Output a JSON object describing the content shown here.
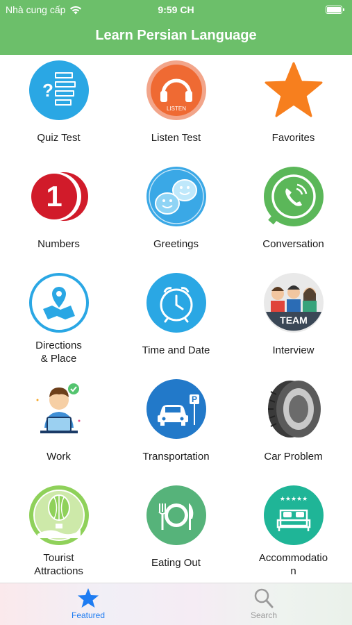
{
  "status_bar": {
    "carrier": "Nhà cung cấp",
    "time": "9:59 CH"
  },
  "header": {
    "title": "Learn Persian Language"
  },
  "items": [
    {
      "label": "Quiz Test"
    },
    {
      "label": "Listen Test",
      "icon_text": "LISTEN"
    },
    {
      "label": "Favorites"
    },
    {
      "label": "Numbers"
    },
    {
      "label": "Greetings"
    },
    {
      "label": "Conversation"
    },
    {
      "label": "Directions\n& Place"
    },
    {
      "label": "Time and Date"
    },
    {
      "label": "Interview",
      "icon_text": "TEAM"
    },
    {
      "label": "Work"
    },
    {
      "label": "Transportation"
    },
    {
      "label": "Car Problem"
    },
    {
      "label": "Tourist\nAttractions"
    },
    {
      "label": "Eating Out"
    },
    {
      "label": "Accommodatio\nn"
    }
  ],
  "tabbar": {
    "featured": "Featured",
    "search": "Search"
  },
  "colors": {
    "header": "#6cbf6a",
    "tab_active": "#1e7cf2",
    "tab_inactive": "#9a9a9a"
  }
}
